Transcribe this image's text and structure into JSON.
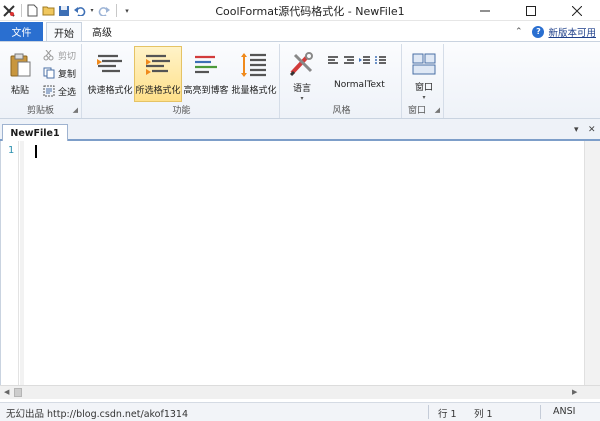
{
  "window": {
    "title": "CoolFormat源代码格式化 - NewFile1"
  },
  "ribbon_tabs": {
    "file": "文件",
    "home": "开始",
    "advanced": "高级",
    "new_version": "新版本可用"
  },
  "groups": {
    "clipboard": {
      "label": "剪贴板",
      "paste": "粘贴",
      "cut": "剪切",
      "copy": "复制",
      "select_all": "全选"
    },
    "function": {
      "label": "功能",
      "quick_format": "快速格式化",
      "selected_format": "所选格式化",
      "highlight_blog": "高亮到博客",
      "batch_format": "批量格式化"
    },
    "style": {
      "label": "风格",
      "language": "语言",
      "normal_text": "NormalText"
    },
    "window": {
      "label": "窗口",
      "window_btn": "窗口"
    }
  },
  "document": {
    "tab_name": "NewFile1",
    "line_numbers": [
      "1"
    ]
  },
  "statusbar": {
    "left_text": "无幻出品 http://blog.csdn.net/akof1314",
    "row": "行 1",
    "col": "列 1",
    "encoding": "ANSI"
  },
  "colors": {
    "file_tab": "#2a6fd0",
    "highlight": "#ffe08a",
    "line_number": "#2b91af"
  }
}
